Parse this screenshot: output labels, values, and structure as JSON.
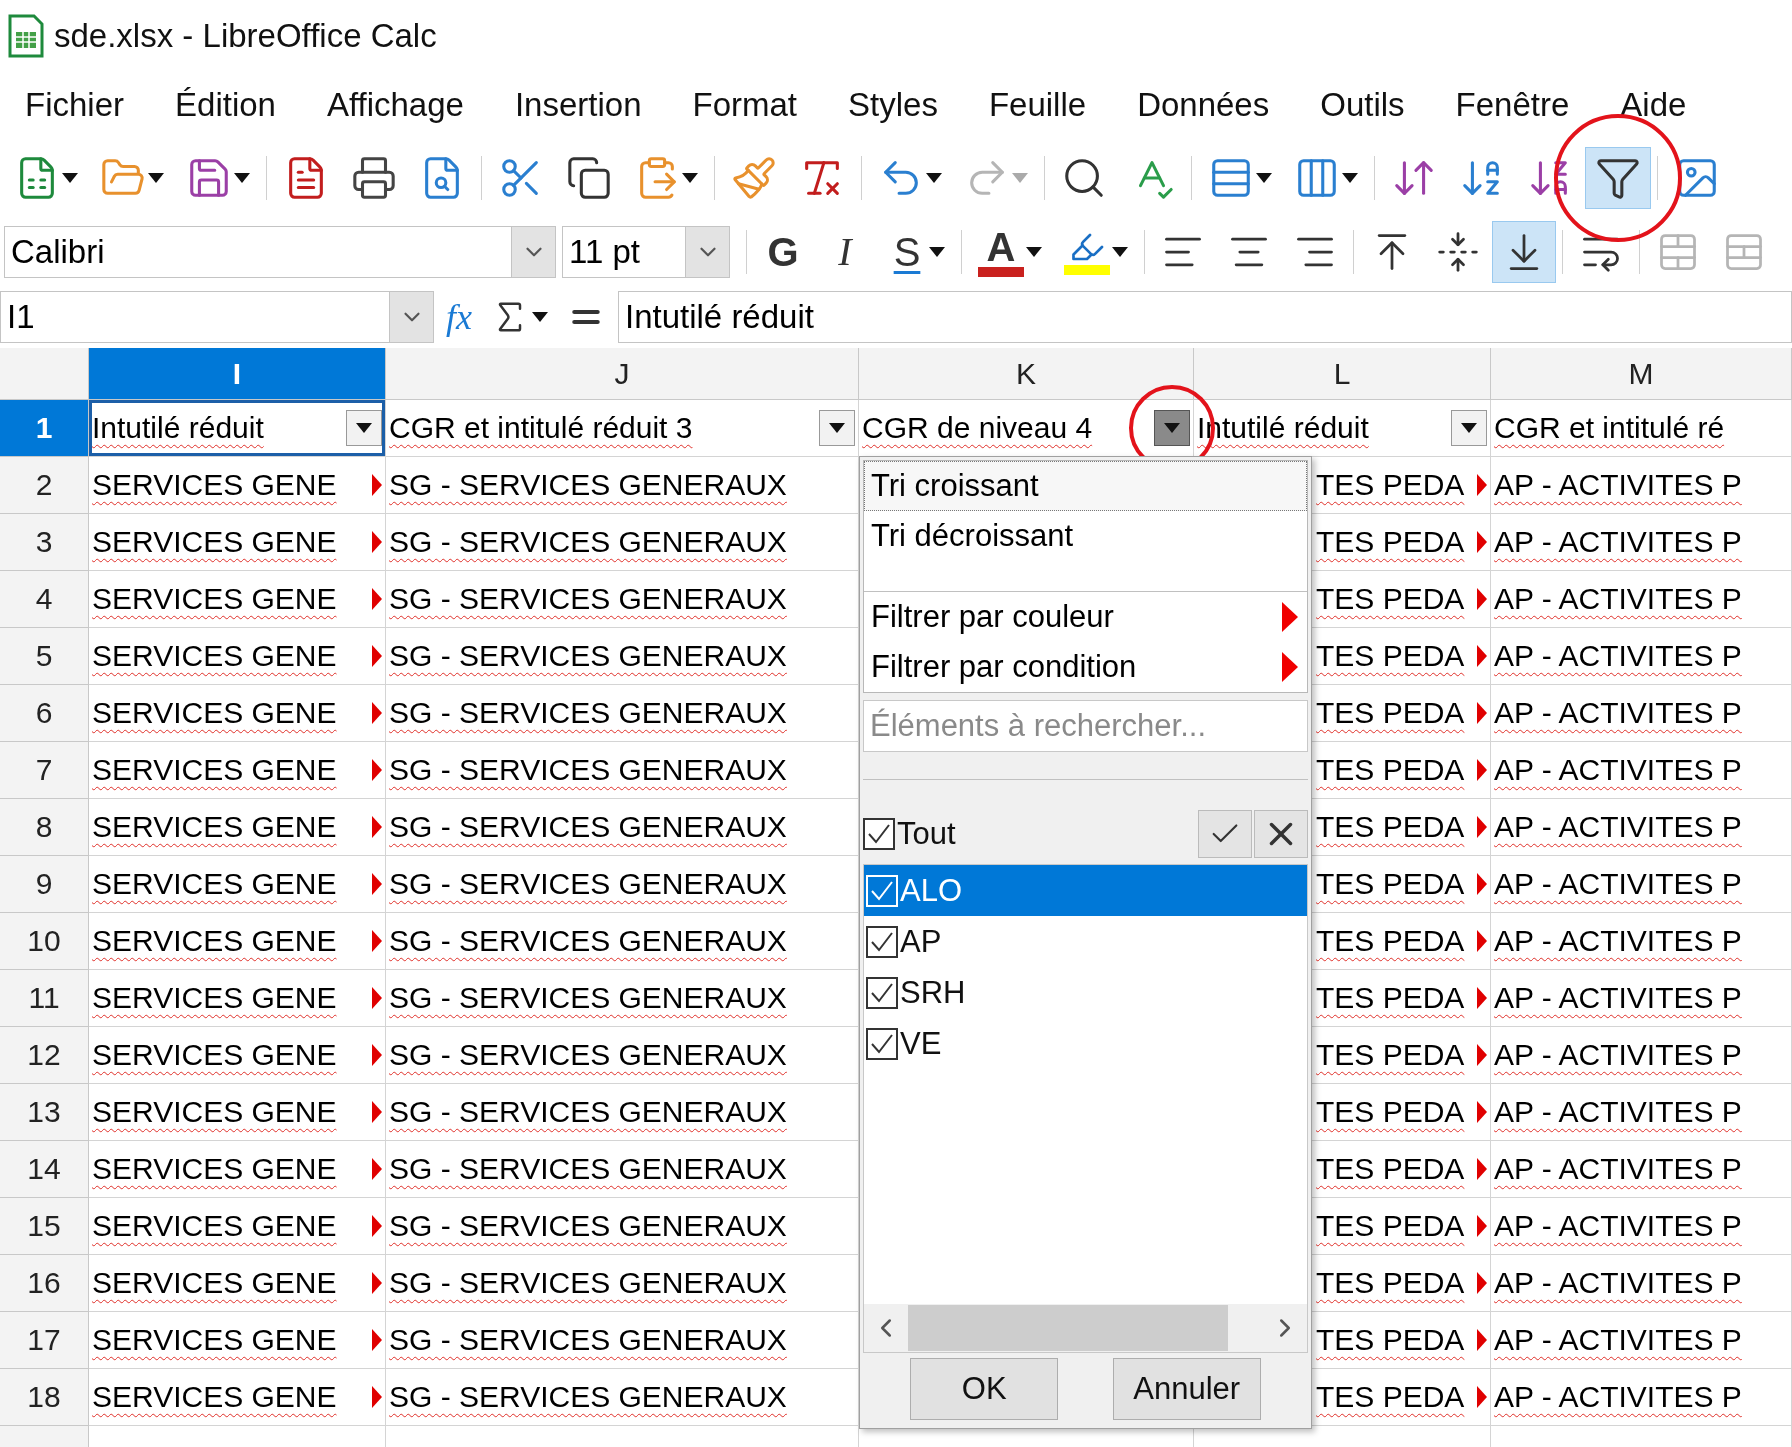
{
  "window": {
    "title": "sde.xlsx - LibreOffice Calc"
  },
  "menu": [
    "Fichier",
    "Édition",
    "Affichage",
    "Insertion",
    "Format",
    "Styles",
    "Feuille",
    "Données",
    "Outils",
    "Fenêtre",
    "Aide"
  ],
  "standard_toolbar": {
    "groups": [
      [
        {
          "dropdown": true,
          "disabled": false,
          "selected": false
        },
        {
          "dropdown": true,
          "disabled": false,
          "selected": false
        },
        {
          "dropdown": true,
          "disabled": false,
          "selected": false
        }
      ],
      [
        {
          "dropdown": false,
          "disabled": false,
          "selected": false
        },
        {
          "dropdown": false,
          "disabled": false,
          "selected": false
        },
        {
          "dropdown": false,
          "disabled": false,
          "selected": false
        }
      ],
      [
        {
          "dropdown": false,
          "disabled": false,
          "selected": false
        },
        {
          "dropdown": false,
          "disabled": false,
          "selected": false
        },
        {
          "dropdown": true,
          "disabled": false,
          "selected": false
        }
      ],
      [
        {
          "dropdown": false,
          "disabled": false,
          "selected": false
        },
        {
          "dropdown": false,
          "disabled": false,
          "selected": false
        }
      ],
      [
        {
          "dropdown": true,
          "disabled": false,
          "selected": false
        },
        {
          "dropdown": true,
          "disabled": true,
          "selected": false
        }
      ],
      [
        {
          "dropdown": false,
          "disabled": false,
          "selected": false
        },
        {
          "dropdown": false,
          "disabled": false,
          "selected": false
        }
      ],
      [
        {
          "dropdown": true,
          "disabled": false,
          "selected": false
        },
        {
          "dropdown": true,
          "disabled": false,
          "selected": false
        }
      ],
      [
        {
          "dropdown": false,
          "disabled": false,
          "selected": false
        },
        {
          "dropdown": false,
          "disabled": false,
          "selected": false
        },
        {
          "dropdown": false,
          "disabled": false,
          "selected": false
        },
        {
          "dropdown": false,
          "disabled": false,
          "selected": true,
          "highlighted": true
        }
      ],
      [
        {
          "dropdown": false,
          "disabled": false,
          "selected": false
        }
      ]
    ]
  },
  "formatting_toolbar": {
    "font_name": "Calibri",
    "font_size": "11 pt",
    "groups": [
      [
        {
          "kind": "bold",
          "label": "G",
          "dropdown": false,
          "disabled": false,
          "selected": false
        },
        {
          "kind": "italic",
          "label": "I",
          "dropdown": false,
          "disabled": false,
          "selected": false
        },
        {
          "kind": "underline",
          "label": "S",
          "dropdown": true,
          "disabled": false,
          "selected": false
        }
      ],
      [
        {
          "kind": "font_color",
          "label": "A",
          "color": "#c9211e",
          "dropdown": true,
          "disabled": false,
          "selected": false
        },
        {
          "kind": "highlight",
          "color": "#ffff00",
          "dropdown": true,
          "disabled": false,
          "selected": false
        }
      ],
      [
        {
          "kind": "icon",
          "dropdown": false,
          "disabled": false,
          "selected": false
        },
        {
          "kind": "icon",
          "dropdown": false,
          "disabled": false,
          "selected": false
        },
        {
          "kind": "icon",
          "dropdown": false,
          "disabled": false,
          "selected": false
        }
      ],
      [
        {
          "kind": "icon",
          "dropdown": false,
          "disabled": false,
          "selected": false
        },
        {
          "kind": "icon",
          "dropdown": false,
          "disabled": false,
          "selected": false
        },
        {
          "kind": "icon",
          "dropdown": false,
          "disabled": false,
          "selected": true
        }
      ],
      [
        {
          "kind": "icon",
          "dropdown": false,
          "disabled": false,
          "selected": false
        }
      ],
      [
        {
          "kind": "icon",
          "dropdown": false,
          "disabled": true,
          "selected": false
        },
        {
          "kind": "icon",
          "dropdown": false,
          "disabled": true,
          "selected": false
        }
      ]
    ]
  },
  "formula_bar": {
    "cell_reference": "I1",
    "function_wizard": "fx",
    "content": "Intutilé réduit"
  },
  "sheet": {
    "columns": [
      {
        "letter": "I",
        "selected": true
      },
      {
        "letter": "J",
        "selected": false
      },
      {
        "letter": "K",
        "selected": false
      },
      {
        "letter": "L",
        "selected": false
      },
      {
        "letter": "M",
        "selected": false
      }
    ],
    "header_row": {
      "number": "1",
      "selected": true,
      "cells": [
        {
          "text": "Intutilé réduit",
          "selected": true,
          "filter_button": true,
          "open": false
        },
        {
          "text": "CGR et intitulé réduit 3",
          "selected": false,
          "filter_button": true,
          "open": false
        },
        {
          "text": "CGR de niveau 4",
          "selected": false,
          "filter_button": true,
          "open": true,
          "highlighted": true
        },
        {
          "text": "Intutilé réduit",
          "selected": false,
          "filter_button": true,
          "open": false
        },
        {
          "text": "CGR et intitulé ré",
          "selected": false,
          "filter_button": false
        }
      ]
    },
    "rows": [
      {
        "number": "2",
        "covered": true,
        "cells": [
          {
            "text": "SERVICES GENE",
            "clipped": true
          },
          {
            "text": "SG - SERVICES GENERAUX",
            "clipped": false
          },
          {
            "text": ""
          },
          {
            "text": "TES PEDA",
            "clipped": true
          },
          {
            "text": "AP - ACTIVITES P",
            "clipped": false
          }
        ]
      },
      {
        "number": "3",
        "covered": true,
        "cells": [
          {
            "text": "SERVICES GENE",
            "clipped": true
          },
          {
            "text": "SG - SERVICES GENERAUX",
            "clipped": false
          },
          {
            "text": ""
          },
          {
            "text": "TES PEDA",
            "clipped": true
          },
          {
            "text": "AP - ACTIVITES P",
            "clipped": false
          }
        ]
      },
      {
        "number": "4",
        "covered": true,
        "cells": [
          {
            "text": "SERVICES GENE",
            "clipped": true
          },
          {
            "text": "SG - SERVICES GENERAUX",
            "clipped": false
          },
          {
            "text": ""
          },
          {
            "text": "TES PEDA",
            "clipped": true
          },
          {
            "text": "AP - ACTIVITES P",
            "clipped": false
          }
        ]
      },
      {
        "number": "5",
        "covered": true,
        "cells": [
          {
            "text": "SERVICES GENE",
            "clipped": true
          },
          {
            "text": "SG - SERVICES GENERAUX",
            "clipped": false
          },
          {
            "text": ""
          },
          {
            "text": "TES PEDA",
            "clipped": true
          },
          {
            "text": "AP - ACTIVITES P",
            "clipped": false
          }
        ]
      },
      {
        "number": "6",
        "covered": true,
        "cells": [
          {
            "text": "SERVICES GENE",
            "clipped": true
          },
          {
            "text": "SG - SERVICES GENERAUX",
            "clipped": false
          },
          {
            "text": ""
          },
          {
            "text": "TES PEDA",
            "clipped": true
          },
          {
            "text": "AP - ACTIVITES P",
            "clipped": false
          }
        ]
      },
      {
        "number": "7",
        "covered": true,
        "cells": [
          {
            "text": "SERVICES GENE",
            "clipped": true
          },
          {
            "text": "SG - SERVICES GENERAUX",
            "clipped": false
          },
          {
            "text": ""
          },
          {
            "text": "TES PEDA",
            "clipped": true
          },
          {
            "text": "AP - ACTIVITES P",
            "clipped": false
          }
        ]
      },
      {
        "number": "8",
        "covered": true,
        "cells": [
          {
            "text": "SERVICES GENE",
            "clipped": true
          },
          {
            "text": "SG - SERVICES GENERAUX",
            "clipped": false
          },
          {
            "text": ""
          },
          {
            "text": "TES PEDA",
            "clipped": true
          },
          {
            "text": "AP - ACTIVITES P",
            "clipped": false
          }
        ]
      },
      {
        "number": "9",
        "covered": true,
        "cells": [
          {
            "text": "SERVICES GENE",
            "clipped": true
          },
          {
            "text": "SG - SERVICES GENERAUX",
            "clipped": false
          },
          {
            "text": ""
          },
          {
            "text": "TES PEDA",
            "clipped": true
          },
          {
            "text": "AP - ACTIVITES P",
            "clipped": false
          }
        ]
      },
      {
        "number": "10",
        "covered": true,
        "cells": [
          {
            "text": "SERVICES GENE",
            "clipped": true
          },
          {
            "text": "SG - SERVICES GENERAUX",
            "clipped": false
          },
          {
            "text": ""
          },
          {
            "text": "TES PEDA",
            "clipped": true
          },
          {
            "text": "AP - ACTIVITES P",
            "clipped": false
          }
        ]
      },
      {
        "number": "11",
        "covered": true,
        "cells": [
          {
            "text": "SERVICES GENE",
            "clipped": true
          },
          {
            "text": "SG - SERVICES GENERAUX",
            "clipped": false
          },
          {
            "text": ""
          },
          {
            "text": "TES PEDA",
            "clipped": true
          },
          {
            "text": "AP - ACTIVITES P",
            "clipped": false
          }
        ]
      },
      {
        "number": "12",
        "covered": true,
        "cells": [
          {
            "text": "SERVICES GENE",
            "clipped": true
          },
          {
            "text": "SG - SERVICES GENERAUX",
            "clipped": false
          },
          {
            "text": ""
          },
          {
            "text": "TES PEDA",
            "clipped": true
          },
          {
            "text": "AP - ACTIVITES P",
            "clipped": false
          }
        ]
      },
      {
        "number": "13",
        "covered": true,
        "cells": [
          {
            "text": "SERVICES GENE",
            "clipped": true
          },
          {
            "text": "SG - SERVICES GENERAUX",
            "clipped": false
          },
          {
            "text": ""
          },
          {
            "text": "TES PEDA",
            "clipped": true
          },
          {
            "text": "AP - ACTIVITES P",
            "clipped": false
          }
        ]
      },
      {
        "number": "14",
        "covered": true,
        "cells": [
          {
            "text": "SERVICES GENE",
            "clipped": true
          },
          {
            "text": "SG - SERVICES GENERAUX",
            "clipped": false
          },
          {
            "text": ""
          },
          {
            "text": "TES PEDA",
            "clipped": true
          },
          {
            "text": "AP - ACTIVITES P",
            "clipped": false
          }
        ]
      },
      {
        "number": "15",
        "covered": true,
        "cells": [
          {
            "text": "SERVICES GENE",
            "clipped": true
          },
          {
            "text": "SG - SERVICES GENERAUX",
            "clipped": false
          },
          {
            "text": ""
          },
          {
            "text": "TES PEDA",
            "clipped": true
          },
          {
            "text": "AP - ACTIVITES P",
            "clipped": false
          }
        ]
      },
      {
        "number": "16",
        "covered": true,
        "cells": [
          {
            "text": "SERVICES GENE",
            "clipped": true
          },
          {
            "text": "SG - SERVICES GENERAUX",
            "clipped": false
          },
          {
            "text": ""
          },
          {
            "text": "TES PEDA",
            "clipped": true
          },
          {
            "text": "AP - ACTIVITES P",
            "clipped": false
          }
        ]
      },
      {
        "number": "17",
        "covered": true,
        "cells": [
          {
            "text": "SERVICES GENE",
            "clipped": true
          },
          {
            "text": "SG - SERVICES GENERAUX",
            "clipped": false
          },
          {
            "text": ""
          },
          {
            "text": "TES PEDA",
            "clipped": true
          },
          {
            "text": "AP - ACTIVITES P",
            "clipped": false
          }
        ]
      },
      {
        "number": "18",
        "covered": true,
        "cells": [
          {
            "text": "SERVICES GENE",
            "clipped": true
          },
          {
            "text": "SG - SERVICES GENERAUX",
            "clipped": false
          },
          {
            "text": ""
          },
          {
            "text": "TES PEDA",
            "clipped": true
          },
          {
            "text": "AP - ACTIVITES P",
            "clipped": false
          }
        ]
      }
    ]
  },
  "autofilter_popup": {
    "menu": [
      {
        "kind": "item",
        "label": "Tri croissant",
        "focused": true,
        "submenu": false
      },
      {
        "kind": "item",
        "label": "Tri décroissant",
        "focused": false,
        "submenu": false
      },
      {
        "kind": "separator"
      },
      {
        "kind": "item",
        "label": "Filtrer par couleur",
        "focused": false,
        "submenu": true
      },
      {
        "kind": "item",
        "label": "Filtrer par condition",
        "focused": false,
        "submenu": true
      }
    ],
    "search": {
      "placeholder": "Éléments à rechercher..."
    },
    "all": {
      "label": "Tout",
      "checked": true
    },
    "values": [
      {
        "label": "ALO",
        "checked": true,
        "selected": true
      },
      {
        "label": "AP",
        "checked": true,
        "selected": false
      },
      {
        "label": "SRH",
        "checked": true,
        "selected": false
      },
      {
        "label": "VE",
        "checked": true,
        "selected": false
      }
    ],
    "buttons": [
      "OK",
      "Annuler"
    ]
  }
}
